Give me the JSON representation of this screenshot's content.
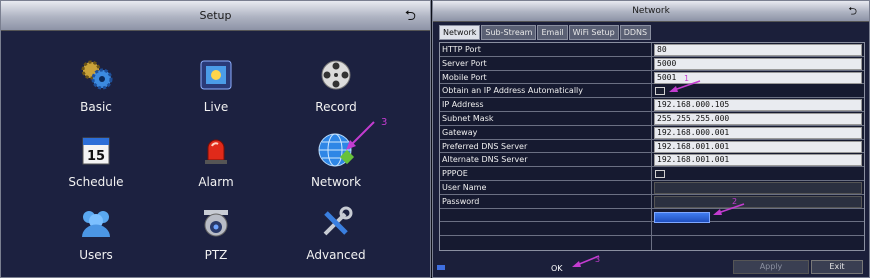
{
  "setup": {
    "title": "Setup",
    "items": [
      {
        "label": "Basic",
        "icon": "gears-icon"
      },
      {
        "label": "Live",
        "icon": "film-icon"
      },
      {
        "label": "Record",
        "icon": "film-reel-icon"
      },
      {
        "label": "Schedule",
        "icon": "calendar-icon",
        "day": "15"
      },
      {
        "label": "Alarm",
        "icon": "alarm-siren-icon"
      },
      {
        "label": "Network",
        "icon": "globe-icon"
      },
      {
        "label": "Users",
        "icon": "users-icon"
      },
      {
        "label": "PTZ",
        "icon": "ptz-camera-icon"
      },
      {
        "label": "Advanced",
        "icon": "tools-icon"
      }
    ],
    "annotation": "3"
  },
  "network": {
    "title": "Network",
    "tabs": [
      "Network",
      "Sub-Stream",
      "Email",
      "WiFi Setup",
      "DDNS"
    ],
    "fields": [
      {
        "label": "HTTP Port",
        "value": "80"
      },
      {
        "label": "Server Port",
        "value": "5000"
      },
      {
        "label": "Mobile Port",
        "value": "5001"
      },
      {
        "label": "Obtain an IP Address Automatically",
        "value": ""
      },
      {
        "label": "IP Address",
        "value": "192.168.000.105"
      },
      {
        "label": "Subnet Mask",
        "value": "255.255.255.000"
      },
      {
        "label": "Gateway",
        "value": "192.168.000.001"
      },
      {
        "label": "Preferred DNS Server",
        "value": "192.168.001.001"
      },
      {
        "label": "Alternate DNS Server",
        "value": "192.168.001.001"
      },
      {
        "label": "PPPOE",
        "value": ""
      },
      {
        "label": "User Name",
        "value": ""
      },
      {
        "label": "Password",
        "value": ""
      }
    ],
    "ok_label": "OK",
    "apply_label": "Apply",
    "exit_label": "Exit",
    "annotations": [
      "1",
      "2",
      "3"
    ]
  }
}
